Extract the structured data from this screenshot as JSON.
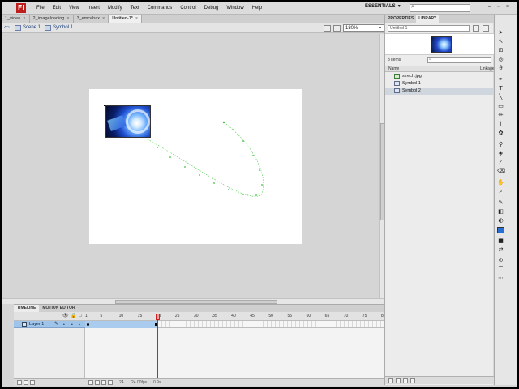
{
  "menubar": {
    "logo": "Fl",
    "items": [
      "File",
      "Edit",
      "View",
      "Insert",
      "Modify",
      "Text",
      "Commands",
      "Control",
      "Debug",
      "Window",
      "Help"
    ],
    "workspace": "ESSENTIALS",
    "search_icon": "search-icon"
  },
  "doc_tabs": [
    {
      "label": "1_video",
      "active": false
    },
    {
      "label": "2_imageloading",
      "active": false
    },
    {
      "label": "3_emcebax",
      "active": false
    },
    {
      "label": "Untitled-1*",
      "active": true
    }
  ],
  "edit_bar": {
    "scene": "Scene 1",
    "symbol": "Symbol 1",
    "zoom": "180%"
  },
  "timeline": {
    "tabs": [
      "TIMELINE",
      "MOTION EDITOR"
    ],
    "layer_name": "Layer 1",
    "ruler": [
      "1",
      "5",
      "10",
      "15",
      "20",
      "25",
      "30",
      "35",
      "40",
      "45",
      "50",
      "55",
      "60",
      "65",
      "70",
      "75",
      "80",
      "85",
      "90",
      "95"
    ],
    "current_frame": "24",
    "fps": "24.00fps",
    "time": "0.9s"
  },
  "library": {
    "tabs": [
      "PROPERTIES",
      "LIBRARY"
    ],
    "document": "Untitled-1",
    "item_count": "3 items",
    "col_name": "Name",
    "col_linkage": "Linkage",
    "items": [
      {
        "label": "strech.jpg",
        "type": "bitmap",
        "selected": false
      },
      {
        "label": "Symbol 1",
        "type": "movieclip",
        "selected": false
      },
      {
        "label": "Symbol 2",
        "type": "movieclip",
        "selected": true
      }
    ]
  },
  "colors": {
    "accent": "#9fc4ea",
    "playhead": "#d02020",
    "motion_path": "#5fd35f"
  }
}
